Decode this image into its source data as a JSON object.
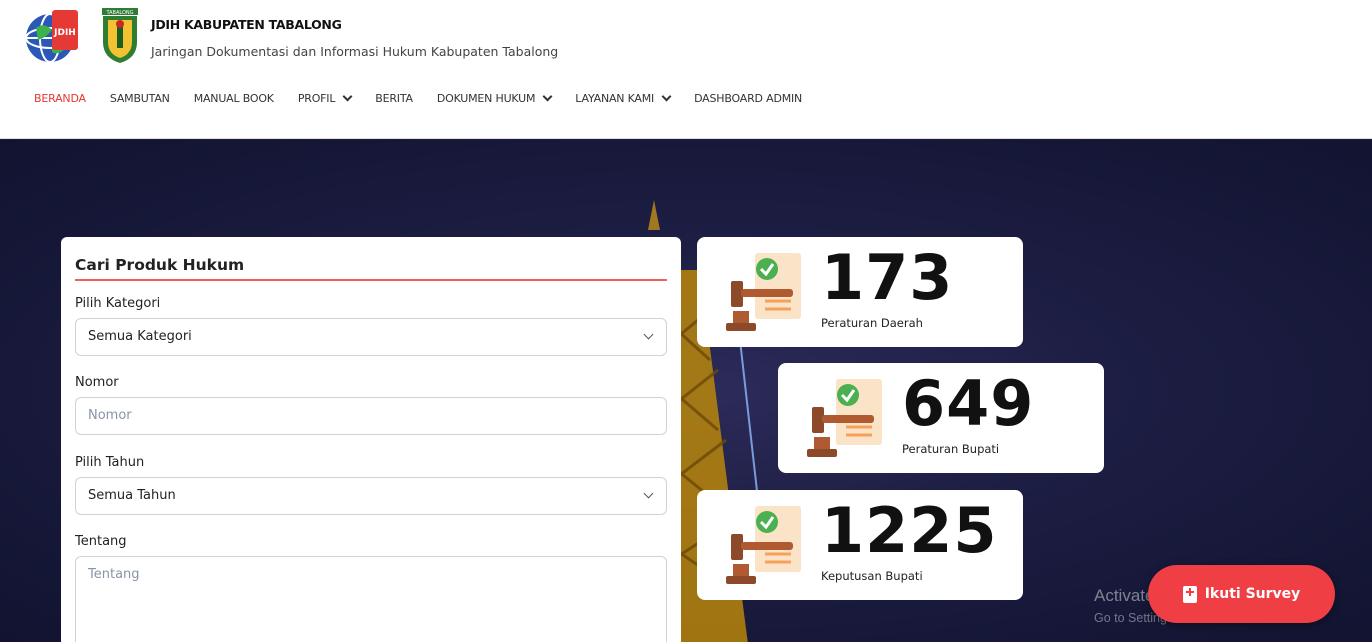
{
  "header": {
    "title": "JDIH KABUPATEN TABALONG",
    "subtitle": "Jaringan Dokumentasi dan Informasi Hukum Kabupaten Tabalong",
    "logo_text": "JDIH",
    "crest_text": "TABALONG"
  },
  "nav": {
    "items": [
      {
        "label": "BERANDA",
        "active": true,
        "dropdown": false
      },
      {
        "label": "SAMBUTAN",
        "active": false,
        "dropdown": false
      },
      {
        "label": "MANUAL BOOK",
        "active": false,
        "dropdown": false
      },
      {
        "label": "PROFIL",
        "active": false,
        "dropdown": true
      },
      {
        "label": "BERITA",
        "active": false,
        "dropdown": false
      },
      {
        "label": "DOKUMEN HUKUM",
        "active": false,
        "dropdown": true
      },
      {
        "label": "LAYANAN KAMI",
        "active": false,
        "dropdown": true
      },
      {
        "label": "DASHBOARD ADMIN",
        "active": false,
        "dropdown": false
      }
    ]
  },
  "search": {
    "title": "Cari Produk Hukum",
    "kategori_label": "Pilih Kategori",
    "kategori_value": "Semua Kategori",
    "nomor_label": "Nomor",
    "nomor_placeholder": "Nomor",
    "tahun_label": "Pilih Tahun",
    "tahun_value": "Semua Tahun",
    "tentang_label": "Tentang",
    "tentang_placeholder": "Tentang"
  },
  "stats": [
    {
      "number": "173",
      "label": "Peraturan Daerah"
    },
    {
      "number": "649",
      "label": "Peraturan Bupati"
    },
    {
      "number": "1225",
      "label": "Keputusan Bupati"
    }
  ],
  "watermark": {
    "line1": "Activate Windows",
    "line2": "Go to Settings to activate Windows."
  },
  "survey_button": {
    "label": "Ikuti Survey"
  },
  "colors": {
    "accent": "#e53935",
    "survey": "#ef3f45",
    "check": "#4caf50"
  }
}
